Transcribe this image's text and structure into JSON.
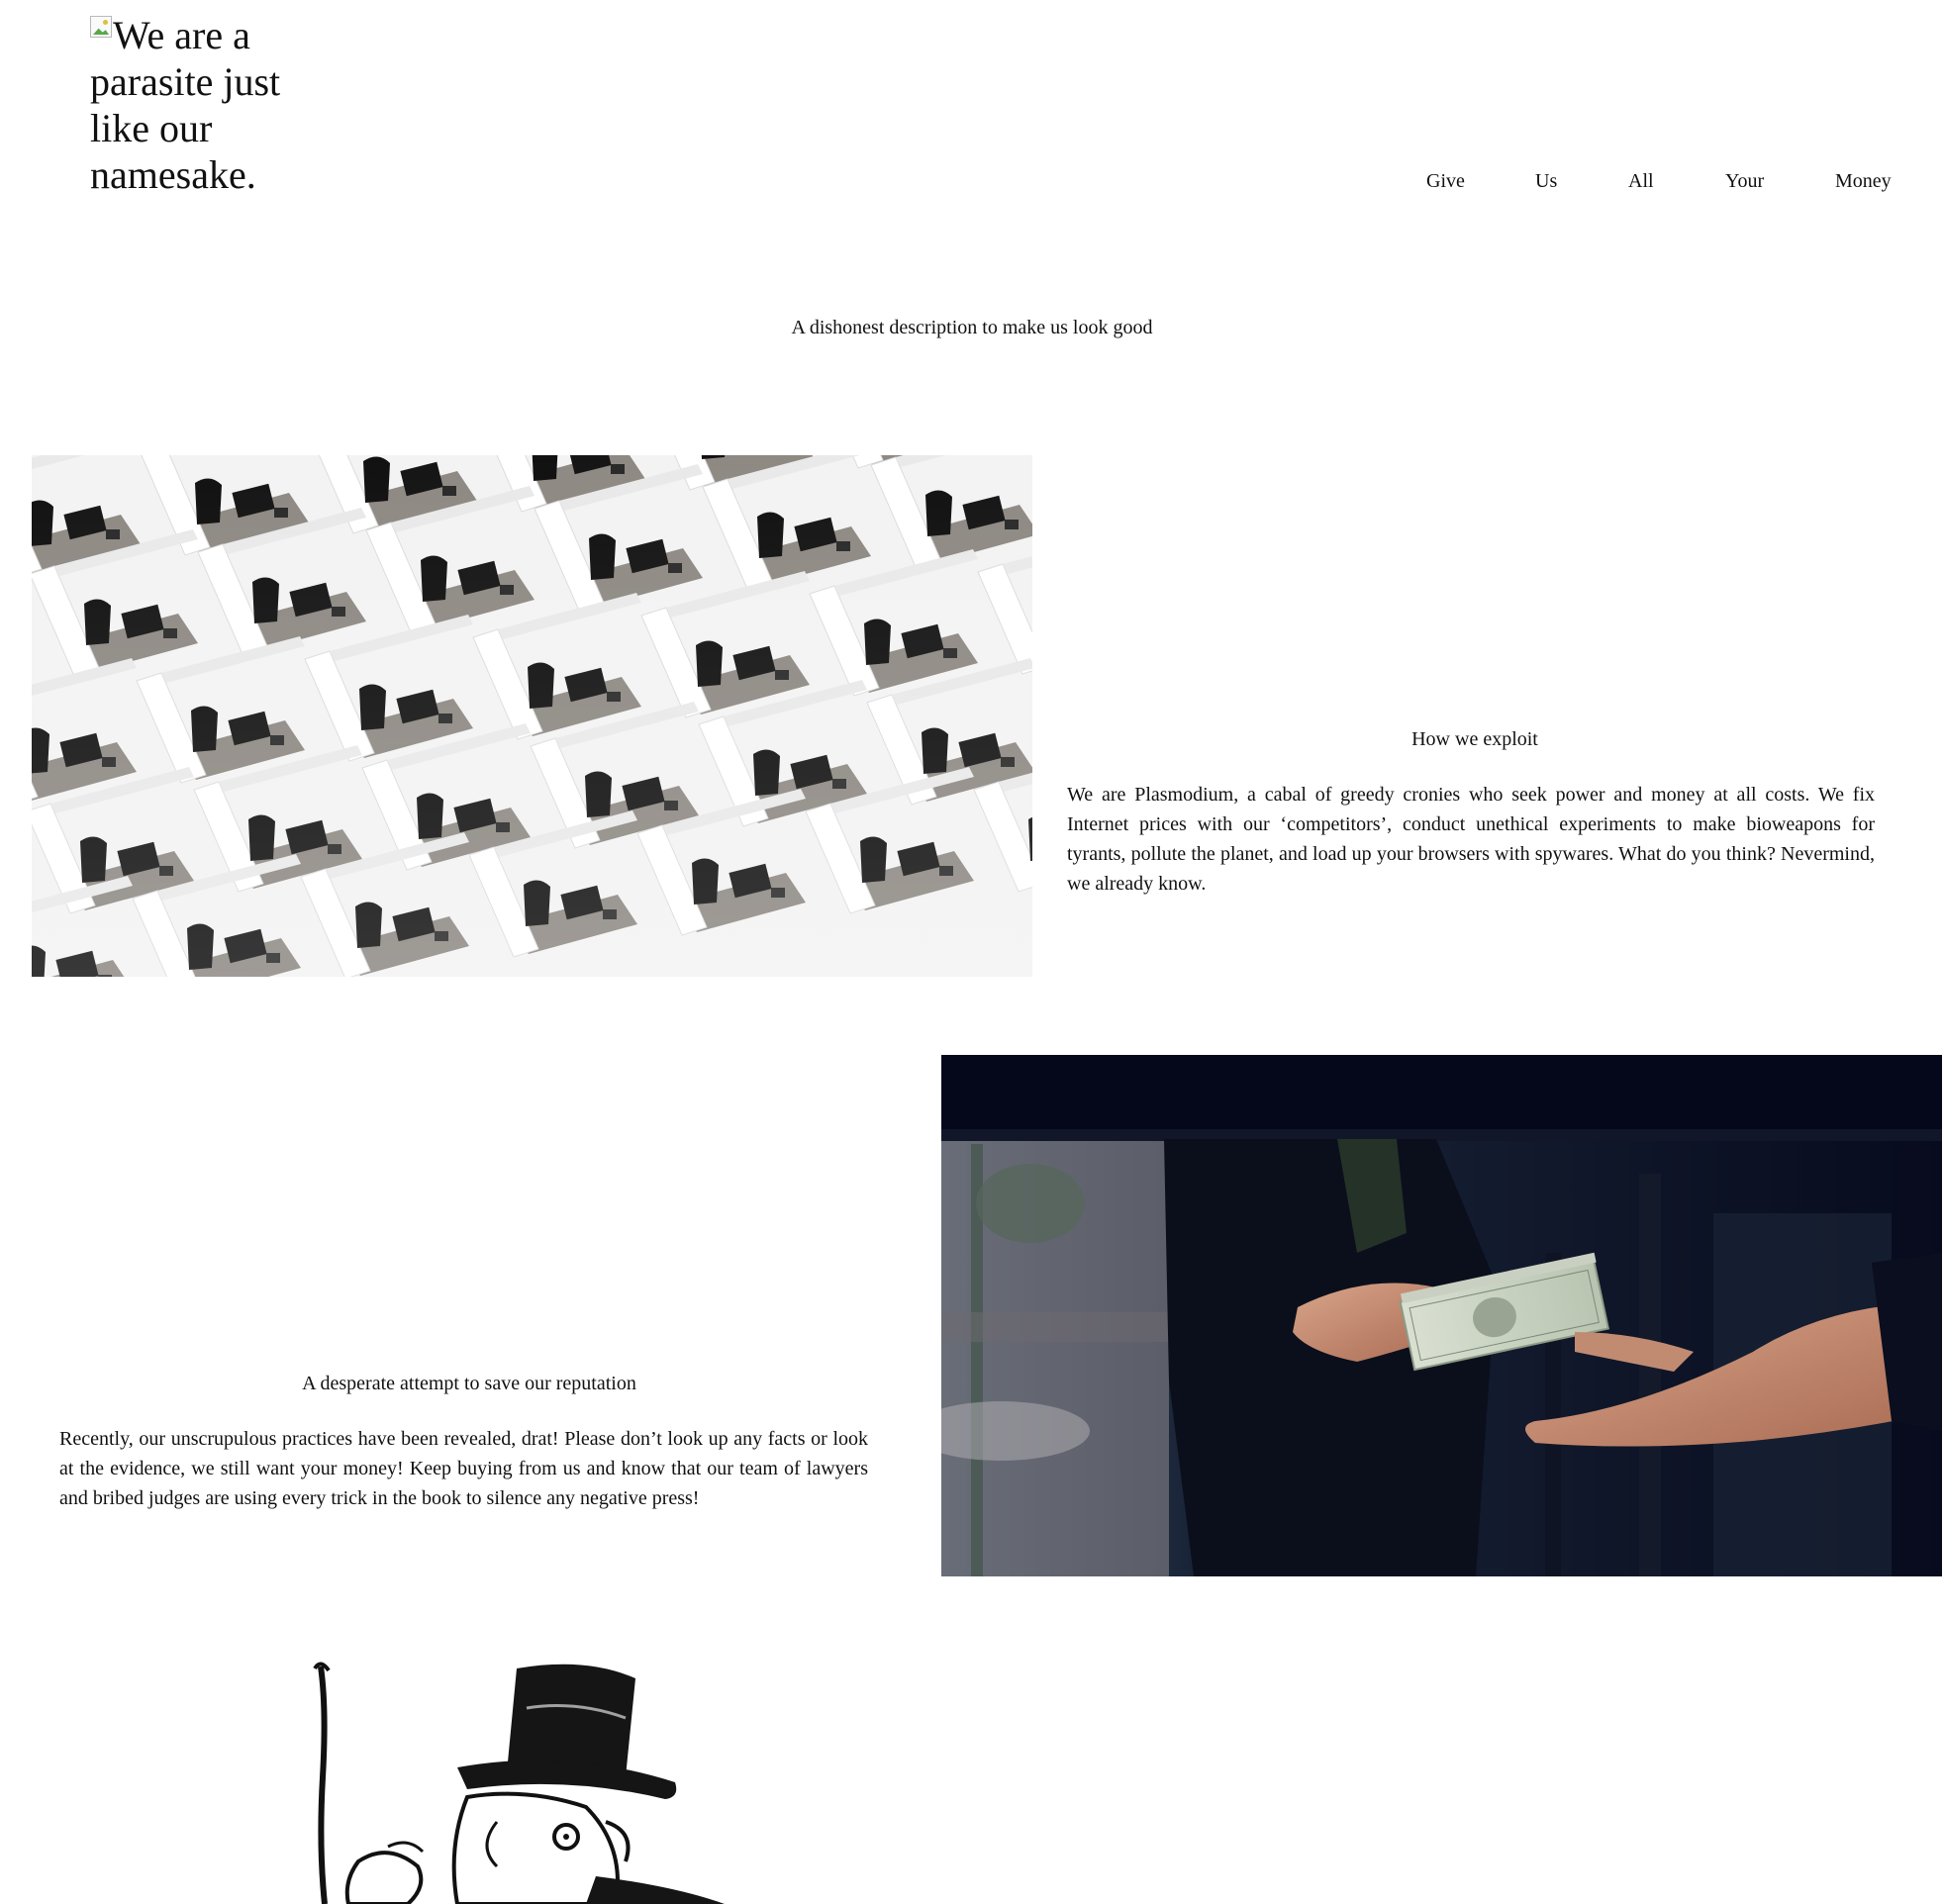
{
  "header": {
    "logo_alt_text": "We are a parasite just like our namesake.",
    "nav": [
      "Give",
      "Us",
      "All",
      "Your",
      "Money"
    ]
  },
  "hero": {
    "tagline": "A dishonest description to make us look good"
  },
  "section_exploit": {
    "heading": "How we exploit",
    "body": "We are Plasmodium, a cabal of greedy cronies who seek power and money at all costs. We fix Internet prices with our ‘competitors’, conduct unethical experiments to make bioweapons for tyrants, pollute the planet, and load up your browsers with spywares. What do you think? Nevermind, we already know."
  },
  "section_reputation": {
    "heading": "A desperate attempt to save our reputation",
    "body": "Recently, our unscrupulous practices have been revealed, drat! Please don’t look up any facts or look at the evidence, we still want your money! Keep buying from us and know that our team of lawyers and bribed judges are using every trick in the book to silence any negative press!"
  },
  "icons": {
    "logo": "broken-image-icon"
  }
}
